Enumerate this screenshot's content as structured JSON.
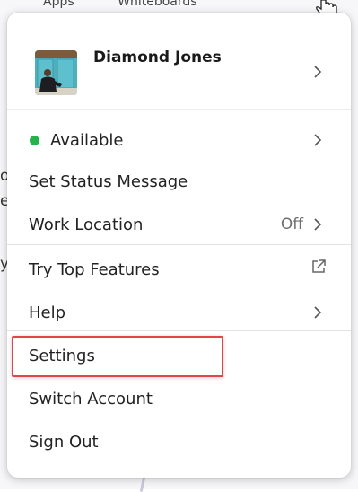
{
  "background": {
    "tabs": [
      "Apps",
      "Whiteboards"
    ],
    "fragments": [
      "o",
      "e",
      "y"
    ]
  },
  "profile": {
    "name": "Diamond Jones"
  },
  "menu": {
    "status_label": "Available",
    "status_color": "#24b24b",
    "set_status_label": "Set Status Message",
    "work_location_label": "Work Location",
    "work_location_value": "Off",
    "top_features_label": "Try Top Features",
    "help_label": "Help",
    "settings_label": "Settings",
    "switch_account_label": "Switch Account",
    "sign_out_label": "Sign Out"
  },
  "colors": {
    "highlight_border": "#e0454b",
    "avatar_bg": "#4aa6b3"
  }
}
